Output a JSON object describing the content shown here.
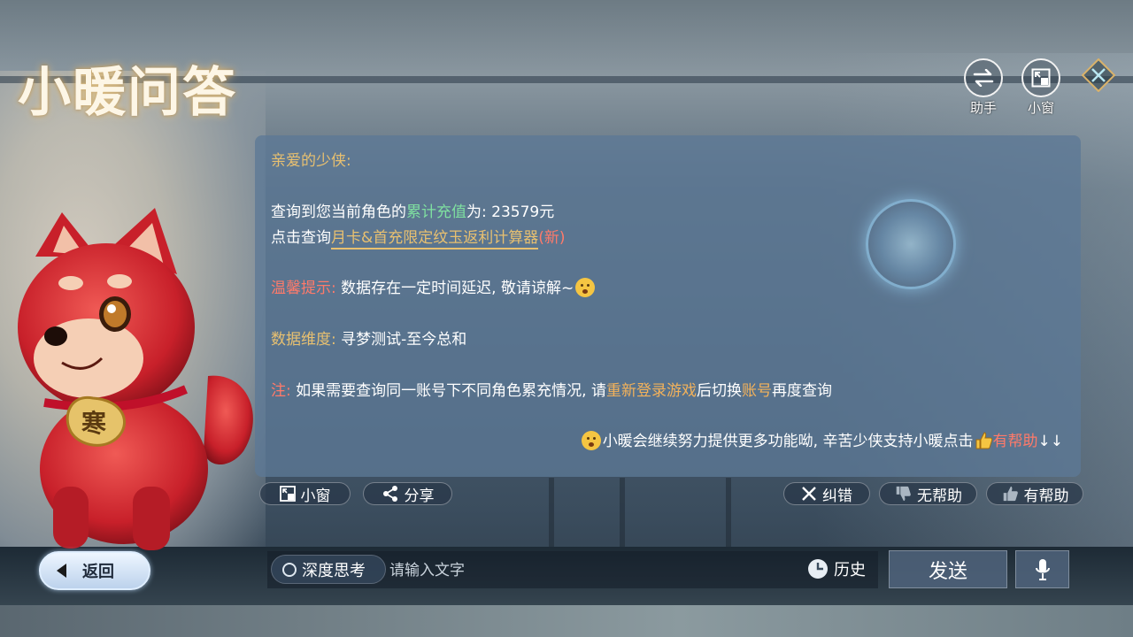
{
  "app": {
    "title": "小暖问答"
  },
  "top_actions": {
    "assistant_label": "助手",
    "small_window_label": "小窗"
  },
  "message": {
    "greeting": "亲爱的少侠:",
    "recharge": {
      "prefix": "查询到您当前角色的",
      "highlight": "累计充值",
      "suffix": "为: 23579元"
    },
    "calculator": {
      "prefix": "点击查询",
      "link": "月卡&首充限定纹玉返利计算器",
      "tag": "(新)"
    },
    "tip": {
      "label": "温馨提示:",
      "text": "数据存在一定时间延迟, 敬请谅解~"
    },
    "dimension": {
      "label": "数据维度:",
      "text": "寻梦测试-至今总和"
    },
    "note": {
      "label": "注:",
      "text1": "如果需要查询同一账号下不同角色累充情况, 请",
      "highlight1": "重新登录游戏",
      "text2": "后切换",
      "highlight2": "账号",
      "text3": "再度查询"
    },
    "footer": {
      "text": "小暖会继续努力提供更多功能呦, 辛苦少侠支持小暖点击",
      "highlight": "有帮助",
      "arrows": "↓↓"
    }
  },
  "message_actions": {
    "small_window": "小窗",
    "share": "分享",
    "correct": "纠错",
    "not_helpful": "无帮助",
    "helpful": "有帮助"
  },
  "bottom_bar": {
    "back": "返回",
    "deep_think": "深度思考",
    "input_placeholder": "请输入文字",
    "history": "历史",
    "send": "发送"
  },
  "mascot": {
    "badge_text": "寒"
  },
  "colors": {
    "gold": "#e8c070",
    "green": "#7fe0a0",
    "red": "#ff7a6a",
    "panel": "#5c7896"
  }
}
